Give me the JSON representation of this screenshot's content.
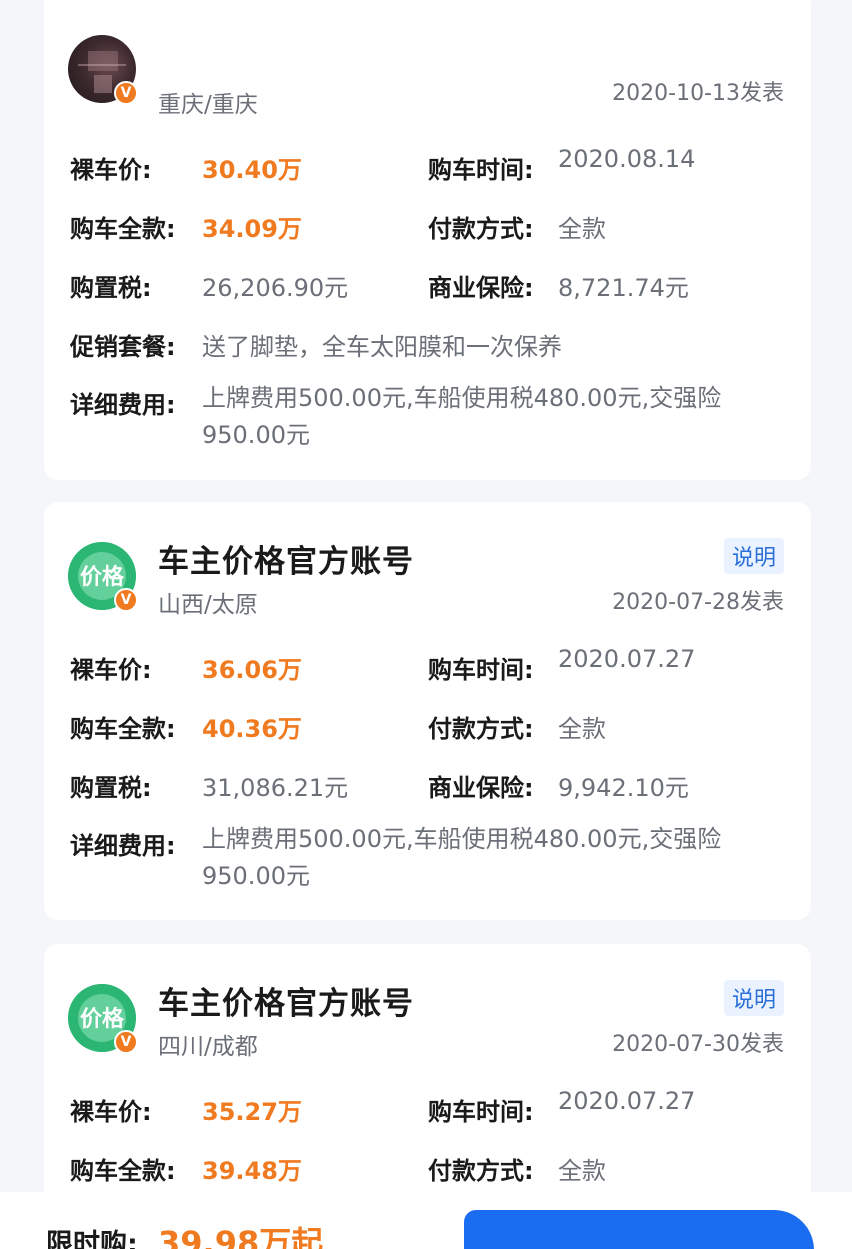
{
  "labels": {
    "bare_price": "裸车价:",
    "purchase_time": "购车时间:",
    "total_price": "购车全款:",
    "payment_method": "付款方式:",
    "purchase_tax": "购置税:",
    "commercial_insurance": "商业保险:",
    "promotion": "促销套餐:",
    "fee_details": "详细费用:"
  },
  "cards": [
    {
      "author": "",
      "verified_icon": "V",
      "region": "重庆/重庆",
      "posted": "2020-10-13发表",
      "bare_price": "30.40万",
      "purchase_time": "2020.08.14",
      "total_price": "34.09万",
      "payment_method": "全款",
      "purchase_tax": "26,206.90元",
      "commercial_insurance": "8,721.74元",
      "promotion": "送了脚垫，全车太阳膜和一次保养",
      "fee_details": "上牌费用500.00元,车船使用税480.00元,交强险950.00元"
    },
    {
      "author": "车主价格官方账号",
      "verified_icon": "V",
      "explain_label": "说明",
      "region": "山西/太原",
      "posted": "2020-07-28发表",
      "bare_price": "36.06万",
      "purchase_time": "2020.07.27",
      "total_price": "40.36万",
      "payment_method": "全款",
      "purchase_tax": "31,086.21元",
      "commercial_insurance": "9,942.10元",
      "fee_details": "上牌费用500.00元,车船使用税480.00元,交强险950.00元"
    },
    {
      "author": "车主价格官方账号",
      "verified_icon": "V",
      "explain_label": "说明",
      "region": "四川/成都",
      "posted": "2020-07-30发表",
      "bare_price": "35.27万",
      "purchase_time": "2020.07.27",
      "total_price": "39.48万",
      "payment_method": "全款"
    }
  ],
  "bottom_bar": {
    "promo_label": "限时购:",
    "promo_value": "39.98万起"
  },
  "colors": {
    "accent_orange": "#f07a1f",
    "button_blue": "#1a6cf0",
    "explain_blue": "#2a6fd8"
  }
}
